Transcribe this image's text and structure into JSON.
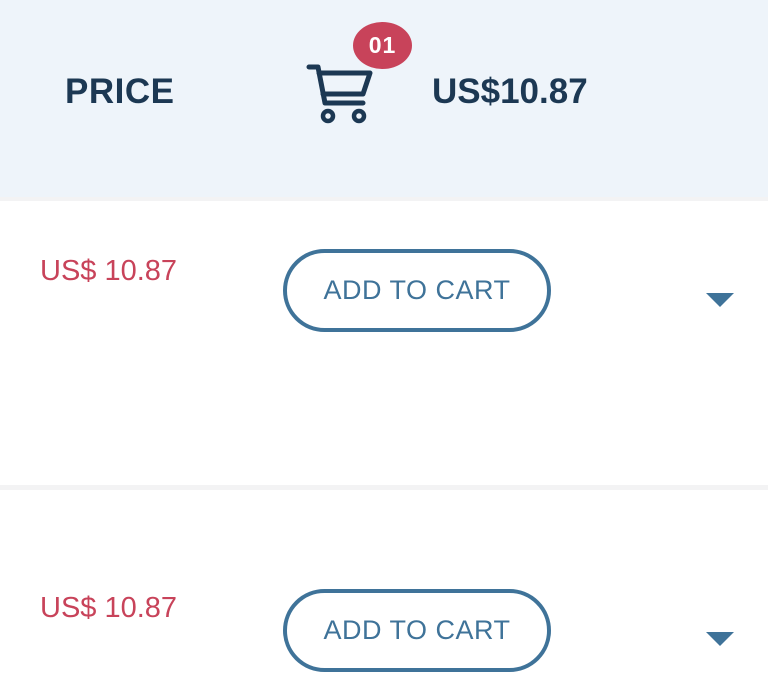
{
  "header": {
    "price_label": "PRICE",
    "cart_count": "01",
    "cart_total": "US$10.87",
    "icons": {
      "cart": "shopping-cart-icon"
    }
  },
  "products": [
    {
      "price": "US$ 10.87",
      "button_label": "ADD TO CART",
      "expand_icon": "caret-down-icon"
    },
    {
      "price": "US$ 10.87",
      "button_label": "ADD TO CART",
      "expand_icon": "caret-down-icon"
    }
  ],
  "colors": {
    "header_bg": "#eef4fa",
    "heading_text": "#1c3853",
    "accent_red": "#c8435a",
    "button_blue": "#3f7399"
  }
}
